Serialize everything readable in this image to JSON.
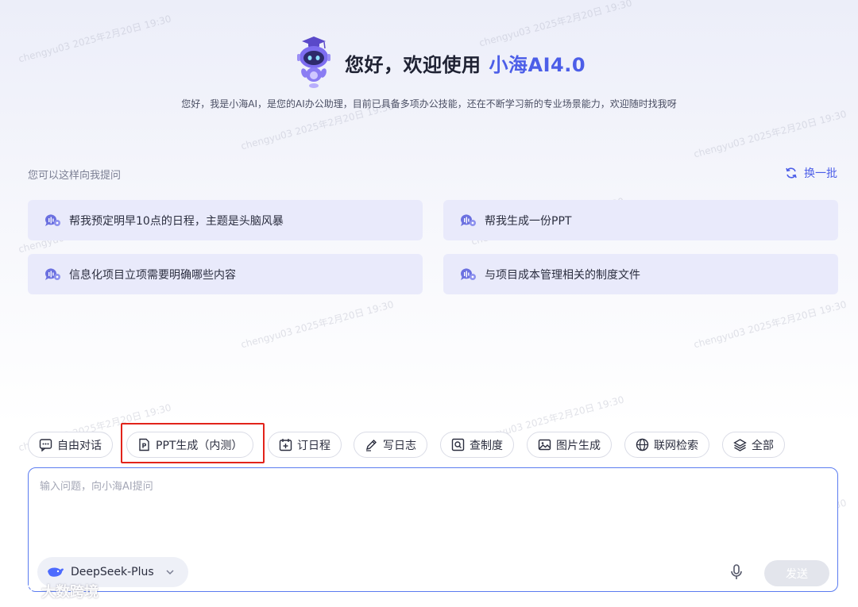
{
  "hero": {
    "title_prefix": "您好，欢迎使用",
    "title_brand": "小海AI4.0",
    "subtitle": "您好，我是小海AI，是您的AI办公助理，目前已具备多项办公技能，还在不断学习新的专业场景能力，欢迎随时找我呀"
  },
  "suggestions": {
    "heading": "您可以这样向我提问",
    "refresh_label": "换一批",
    "items": [
      {
        "label": "帮我预定明早10点的日程，主题是头脑风暴"
      },
      {
        "label": "帮我生成一份PPT"
      },
      {
        "label": "信息化项目立项需要明确哪些内容"
      },
      {
        "label": "与项目成本管理相关的制度文件"
      }
    ]
  },
  "tools": [
    {
      "label": "自由对话",
      "icon": "chat-bubble-icon"
    },
    {
      "label": "PPT生成（内测）",
      "icon": "ppt-file-icon"
    },
    {
      "label": "订日程",
      "icon": "calendar-add-icon"
    },
    {
      "label": "写日志",
      "icon": "pen-icon"
    },
    {
      "label": "查制度",
      "icon": "search-doc-icon"
    },
    {
      "label": "图片生成",
      "icon": "image-icon"
    },
    {
      "label": "联网检索",
      "icon": "globe-icon"
    },
    {
      "label": "全部",
      "icon": "layers-icon"
    }
  ],
  "composer": {
    "placeholder": "输入问题，向小海AI提问",
    "model": "DeepSeek-Plus",
    "send_label": "发送"
  },
  "watermark": {
    "text": "chengyu03 2025年2月20日 19:30",
    "brand": "大数跨境"
  },
  "colors": {
    "accent": "#4c5ee8",
    "card_bg": "#e9eafb",
    "highlight_box": "#e2231a",
    "composer_border": "#5b7cf0"
  }
}
